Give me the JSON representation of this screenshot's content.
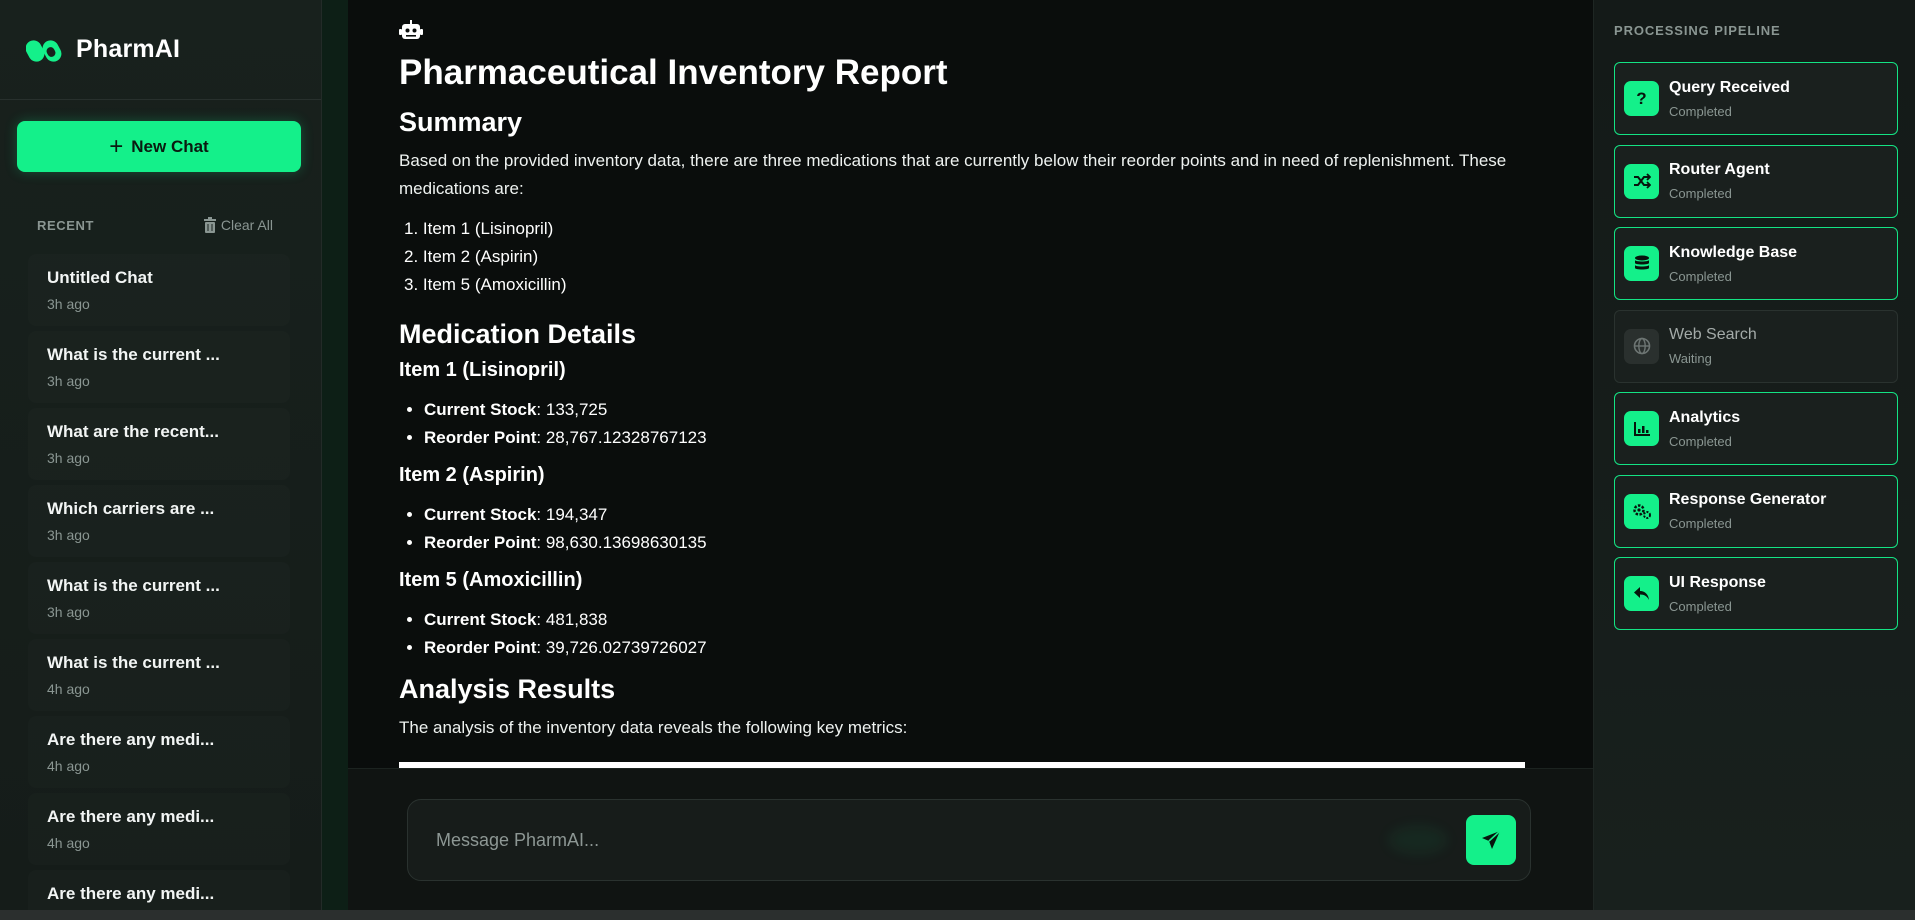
{
  "brand": {
    "name": "PharmAI"
  },
  "sidebar": {
    "new_chat_label": "New Chat",
    "recent_label": "RECENT",
    "clear_all_label": "Clear All",
    "chats": [
      {
        "title": "Untitled Chat",
        "time": "3h ago"
      },
      {
        "title": "What is the current ...",
        "time": "3h ago"
      },
      {
        "title": "What are the recent...",
        "time": "3h ago"
      },
      {
        "title": "Which carriers are ...",
        "time": "3h ago"
      },
      {
        "title": "What is the current ...",
        "time": "3h ago"
      },
      {
        "title": "What is the current ...",
        "time": "4h ago"
      },
      {
        "title": "Are there any medi...",
        "time": "4h ago"
      },
      {
        "title": "Are there any medi...",
        "time": "4h ago"
      },
      {
        "title": "Are there any medi...",
        "time": ""
      }
    ]
  },
  "report": {
    "title": "Pharmaceutical Inventory Report",
    "summary_heading": "Summary",
    "summary_text": "Based on the provided inventory data, there are three medications that are currently below their reorder points and in need of replenishment. These medications are:",
    "summary_items": [
      "1. Item 1 (Lisinopril)",
      "2. Item 2 (Aspirin)",
      "3. Item 5 (Amoxicillin)"
    ],
    "details_heading": "Medication Details",
    "items": [
      {
        "heading": "Item 1 (Lisinopril)",
        "stock_label": "Current Stock",
        "stock": ": 133,725",
        "reorder_label": "Reorder Point",
        "reorder": ": 28,767.12328767123"
      },
      {
        "heading": "Item 2 (Aspirin)",
        "stock_label": "Current Stock",
        "stock": ": 194,347",
        "reorder_label": "Reorder Point",
        "reorder": ": 98,630.13698630135"
      },
      {
        "heading": "Item 5 (Amoxicillin)",
        "stock_label": "Current Stock",
        "stock": ": 481,838",
        "reorder_label": "Reorder Point",
        "reorder": ": 39,726.02739726027"
      }
    ],
    "analysis_heading": "Analysis Results",
    "analysis_text": "The analysis of the inventory data reveals the following key metrics:"
  },
  "composer": {
    "placeholder": "Message PharmAI..."
  },
  "pipeline": {
    "title": "PROCESSING PIPELINE",
    "steps": [
      {
        "name": "Query Received",
        "status": "Completed",
        "icon": "question-icon"
      },
      {
        "name": "Router Agent",
        "status": "Completed",
        "icon": "shuffle-icon"
      },
      {
        "name": "Knowledge Base",
        "status": "Completed",
        "icon": "database-icon"
      },
      {
        "name": "Web Search",
        "status": "Waiting",
        "icon": "globe-icon"
      },
      {
        "name": "Analytics",
        "status": "Completed",
        "icon": "chart-icon"
      },
      {
        "name": "Response Generator",
        "status": "Completed",
        "icon": "gears-icon"
      },
      {
        "name": "UI Response",
        "status": "Completed",
        "icon": "reply-icon"
      }
    ]
  },
  "colors": {
    "accent": "#14f08a",
    "background": "#0a0d0c",
    "sidebar": "#18211d",
    "muted": "#8a9692"
  }
}
